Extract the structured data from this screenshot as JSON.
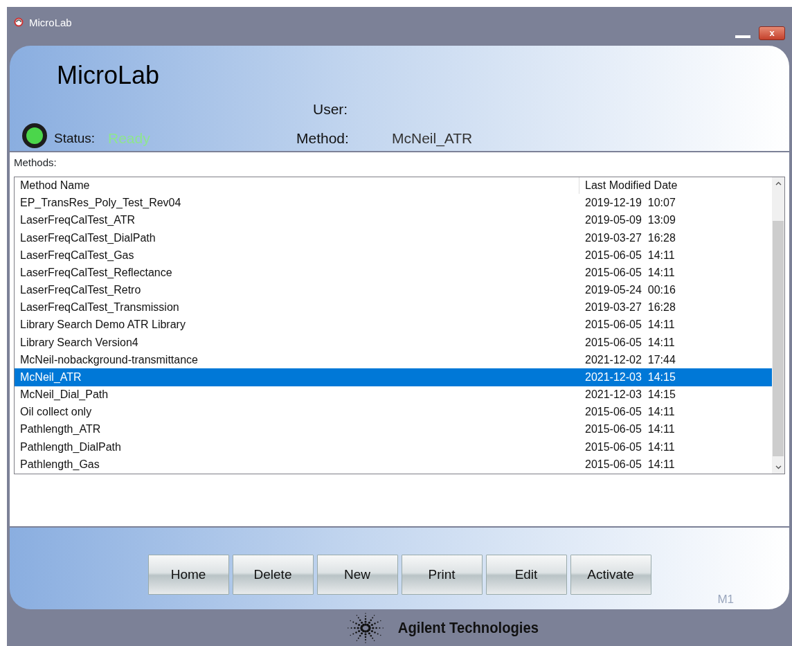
{
  "window": {
    "title": "MicroLab",
    "close_glyph": "x"
  },
  "header": {
    "app_name": "MicroLab",
    "user_label": "User:",
    "status_label": "Status:",
    "status_value": "Ready",
    "status_on": true,
    "method_label": "Method:",
    "method_value": "McNeil_ATR"
  },
  "methods": {
    "label": "Methods:",
    "columns": [
      "Method Name",
      "Last Modified Date"
    ],
    "rows": [
      {
        "name": "EP_TransRes_Poly_Test_Rev04",
        "date": "2019-12-19  10:07",
        "selected": false
      },
      {
        "name": "LaserFreqCalTest_ATR",
        "date": "2019-05-09  13:09",
        "selected": false
      },
      {
        "name": "LaserFreqCalTest_DialPath",
        "date": "2019-03-27  16:28",
        "selected": false
      },
      {
        "name": "LaserFreqCalTest_Gas",
        "date": "2015-06-05  14:11",
        "selected": false
      },
      {
        "name": "LaserFreqCalTest_Reflectance",
        "date": "2015-06-05  14:11",
        "selected": false
      },
      {
        "name": "LaserFreqCalTest_Retro",
        "date": "2019-05-24  00:16",
        "selected": false
      },
      {
        "name": "LaserFreqCalTest_Transmission",
        "date": "2019-03-27  16:28",
        "selected": false
      },
      {
        "name": "Library Search Demo ATR Library",
        "date": "2015-06-05  14:11",
        "selected": false
      },
      {
        "name": "Library Search Version4",
        "date": "2015-06-05  14:11",
        "selected": false
      },
      {
        "name": "McNeil-nobackground-transmittance",
        "date": "2021-12-02  17:44",
        "selected": false
      },
      {
        "name": "McNeil_ATR",
        "date": "2021-12-03  14:15",
        "selected": true
      },
      {
        "name": "McNeil_Dial_Path",
        "date": "2021-12-03  14:15",
        "selected": false
      },
      {
        "name": "Oil collect only",
        "date": "2015-06-05  14:11",
        "selected": false
      },
      {
        "name": "Pathlength_ATR",
        "date": "2015-06-05  14:11",
        "selected": false
      },
      {
        "name": "Pathlength_DialPath",
        "date": "2015-06-05  14:11",
        "selected": false
      },
      {
        "name": "Pathlength_Gas",
        "date": "2015-06-05  14:11",
        "selected": false
      }
    ]
  },
  "buttons": [
    "Home",
    "Delete",
    "New",
    "Print",
    "Edit",
    "Activate"
  ],
  "corner_code": "M1",
  "footer": {
    "brand": "Agilent Technologies"
  }
}
